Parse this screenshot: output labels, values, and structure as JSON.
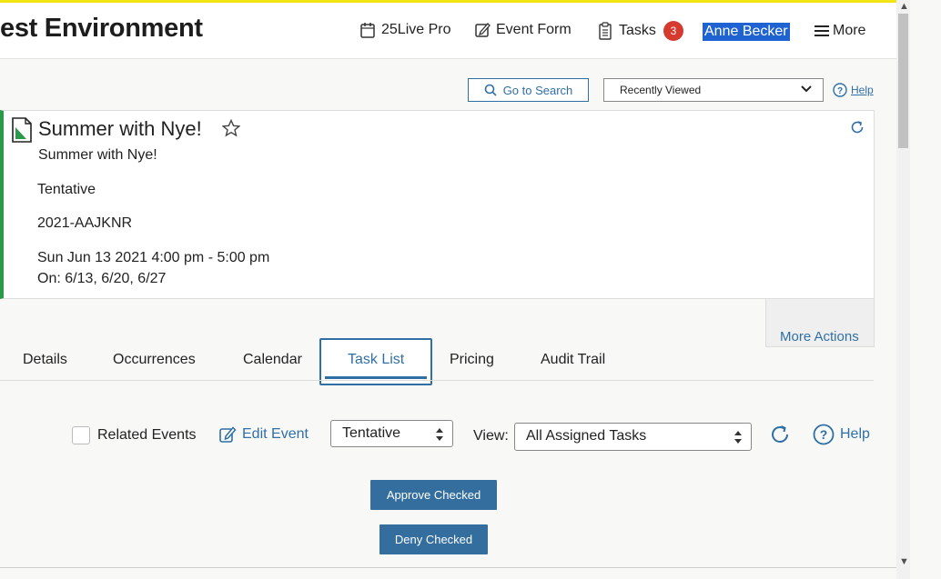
{
  "header": {
    "app_title": "est Environment",
    "nav": {
      "live_pro": "25Live Pro",
      "event_form": "Event Form",
      "tasks": "Tasks",
      "tasks_count": "3"
    },
    "user": "Anne Becker",
    "more": "More"
  },
  "toolbar": {
    "go_to_search": "Go to Search",
    "recently_viewed": "Recently Viewed",
    "help": "Help"
  },
  "event": {
    "title": "Summer with Nye!",
    "subtitle": "Summer with Nye!",
    "state": "Tentative",
    "reference": "2021-AAJKNR",
    "datetime": "Sun Jun 13 2021 4:00 pm - 5:00 pm",
    "occurrences": "On: 6/13, 6/20, 6/27",
    "accent_color": "#2b9a48"
  },
  "more_actions": "More Actions",
  "tabs": [
    {
      "label": "Details"
    },
    {
      "label": "Occurrences"
    },
    {
      "label": "Calendar"
    },
    {
      "label": "Task List",
      "active": true
    },
    {
      "label": "Pricing"
    },
    {
      "label": "Audit Trail"
    }
  ],
  "task_list": {
    "related_events": "Related Events",
    "related_events_checked": false,
    "edit_event": "Edit Event",
    "state_select": "Tentative",
    "view_label": "View:",
    "view_select": "All Assigned Tasks",
    "help": "Help",
    "approve_checked": "Approve Checked",
    "deny_checked": "Deny Checked"
  },
  "colors": {
    "accent": "#2f6fa6",
    "button": "#336e9f",
    "badge": "#d63a2f",
    "top_bar": "#f2e312"
  }
}
